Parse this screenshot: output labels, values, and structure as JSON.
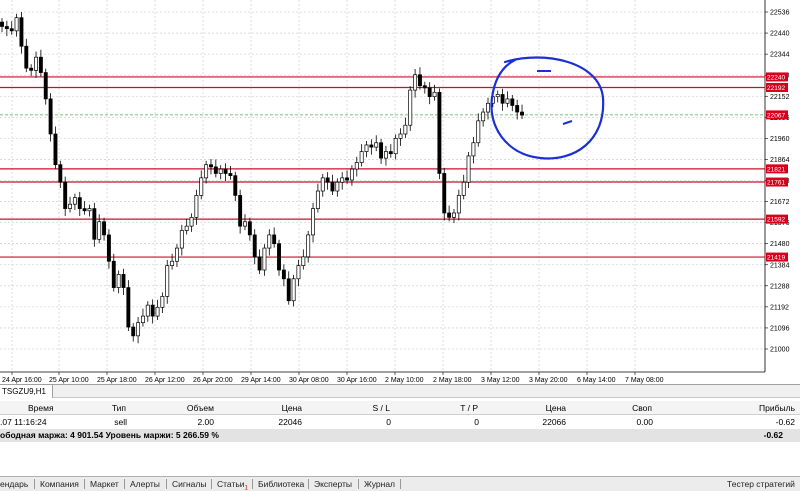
{
  "chart": {
    "symbol_tab": "TSGZU9,H1",
    "price_levels": [
      "22536",
      "22440",
      "22344",
      "22248",
      "22152",
      "22056",
      "21960",
      "21864",
      "21768",
      "21672",
      "21576",
      "21480",
      "21384",
      "21288",
      "21192",
      "21096",
      "21000"
    ],
    "line_tags": [
      "22240",
      "22192",
      "22067",
      "21821",
      "21761",
      "21592",
      "21419"
    ],
    "time_labels": [
      "24 Apr 16:00",
      "25 Apr 10:00",
      "25 Apr 18:00",
      "26 Apr 12:00",
      "26 Apr 20:00",
      "29 Apr 14:00",
      "30 Apr 08:00",
      "30 Apr 16:00",
      "2 May 10:00",
      "2 May 18:00",
      "3 May 12:00",
      "3 May 20:00",
      "6 May 14:00",
      "7 May 08:00"
    ],
    "colors": {
      "background": "#ffffff",
      "grid": "#c8c8c8",
      "candle": "#000000",
      "level_line": "#c8102e",
      "tag_fill": "#d6001c",
      "ask_line": "#3fb53f",
      "annotation": "#1a2fd4"
    }
  },
  "terminal": {
    "headers": {
      "time": "Время",
      "type": "Тип",
      "volume": "Объем",
      "price": "Цена",
      "sl": "S / L",
      "tp": "T / P",
      "price2": "Цена",
      "swap": "Своп",
      "profit": "Прибыль"
    },
    "order": {
      "time": ".07 11:16:24",
      "type": "sell",
      "volume": "2.00",
      "price": "22046",
      "sl": "0",
      "tp": "0",
      "price2": "22066",
      "swap": "0.00",
      "profit": "-0.62"
    },
    "summary": {
      "text": "ободная маржа: 4 901.54  Уровень маржи: 5 266.59 %",
      "profit": "-0.62"
    }
  },
  "bottom_tabs": {
    "calendar": "ендарь",
    "company": "Компания",
    "market": "Маркет",
    "alerts": "Алерты",
    "signals": "Сигналы",
    "articles": "Статьи",
    "articles_badge": "1",
    "library": "Библиотека",
    "experts": "Эксперты",
    "journal": "Журнал",
    "tester": "Тестер стратегий"
  }
}
